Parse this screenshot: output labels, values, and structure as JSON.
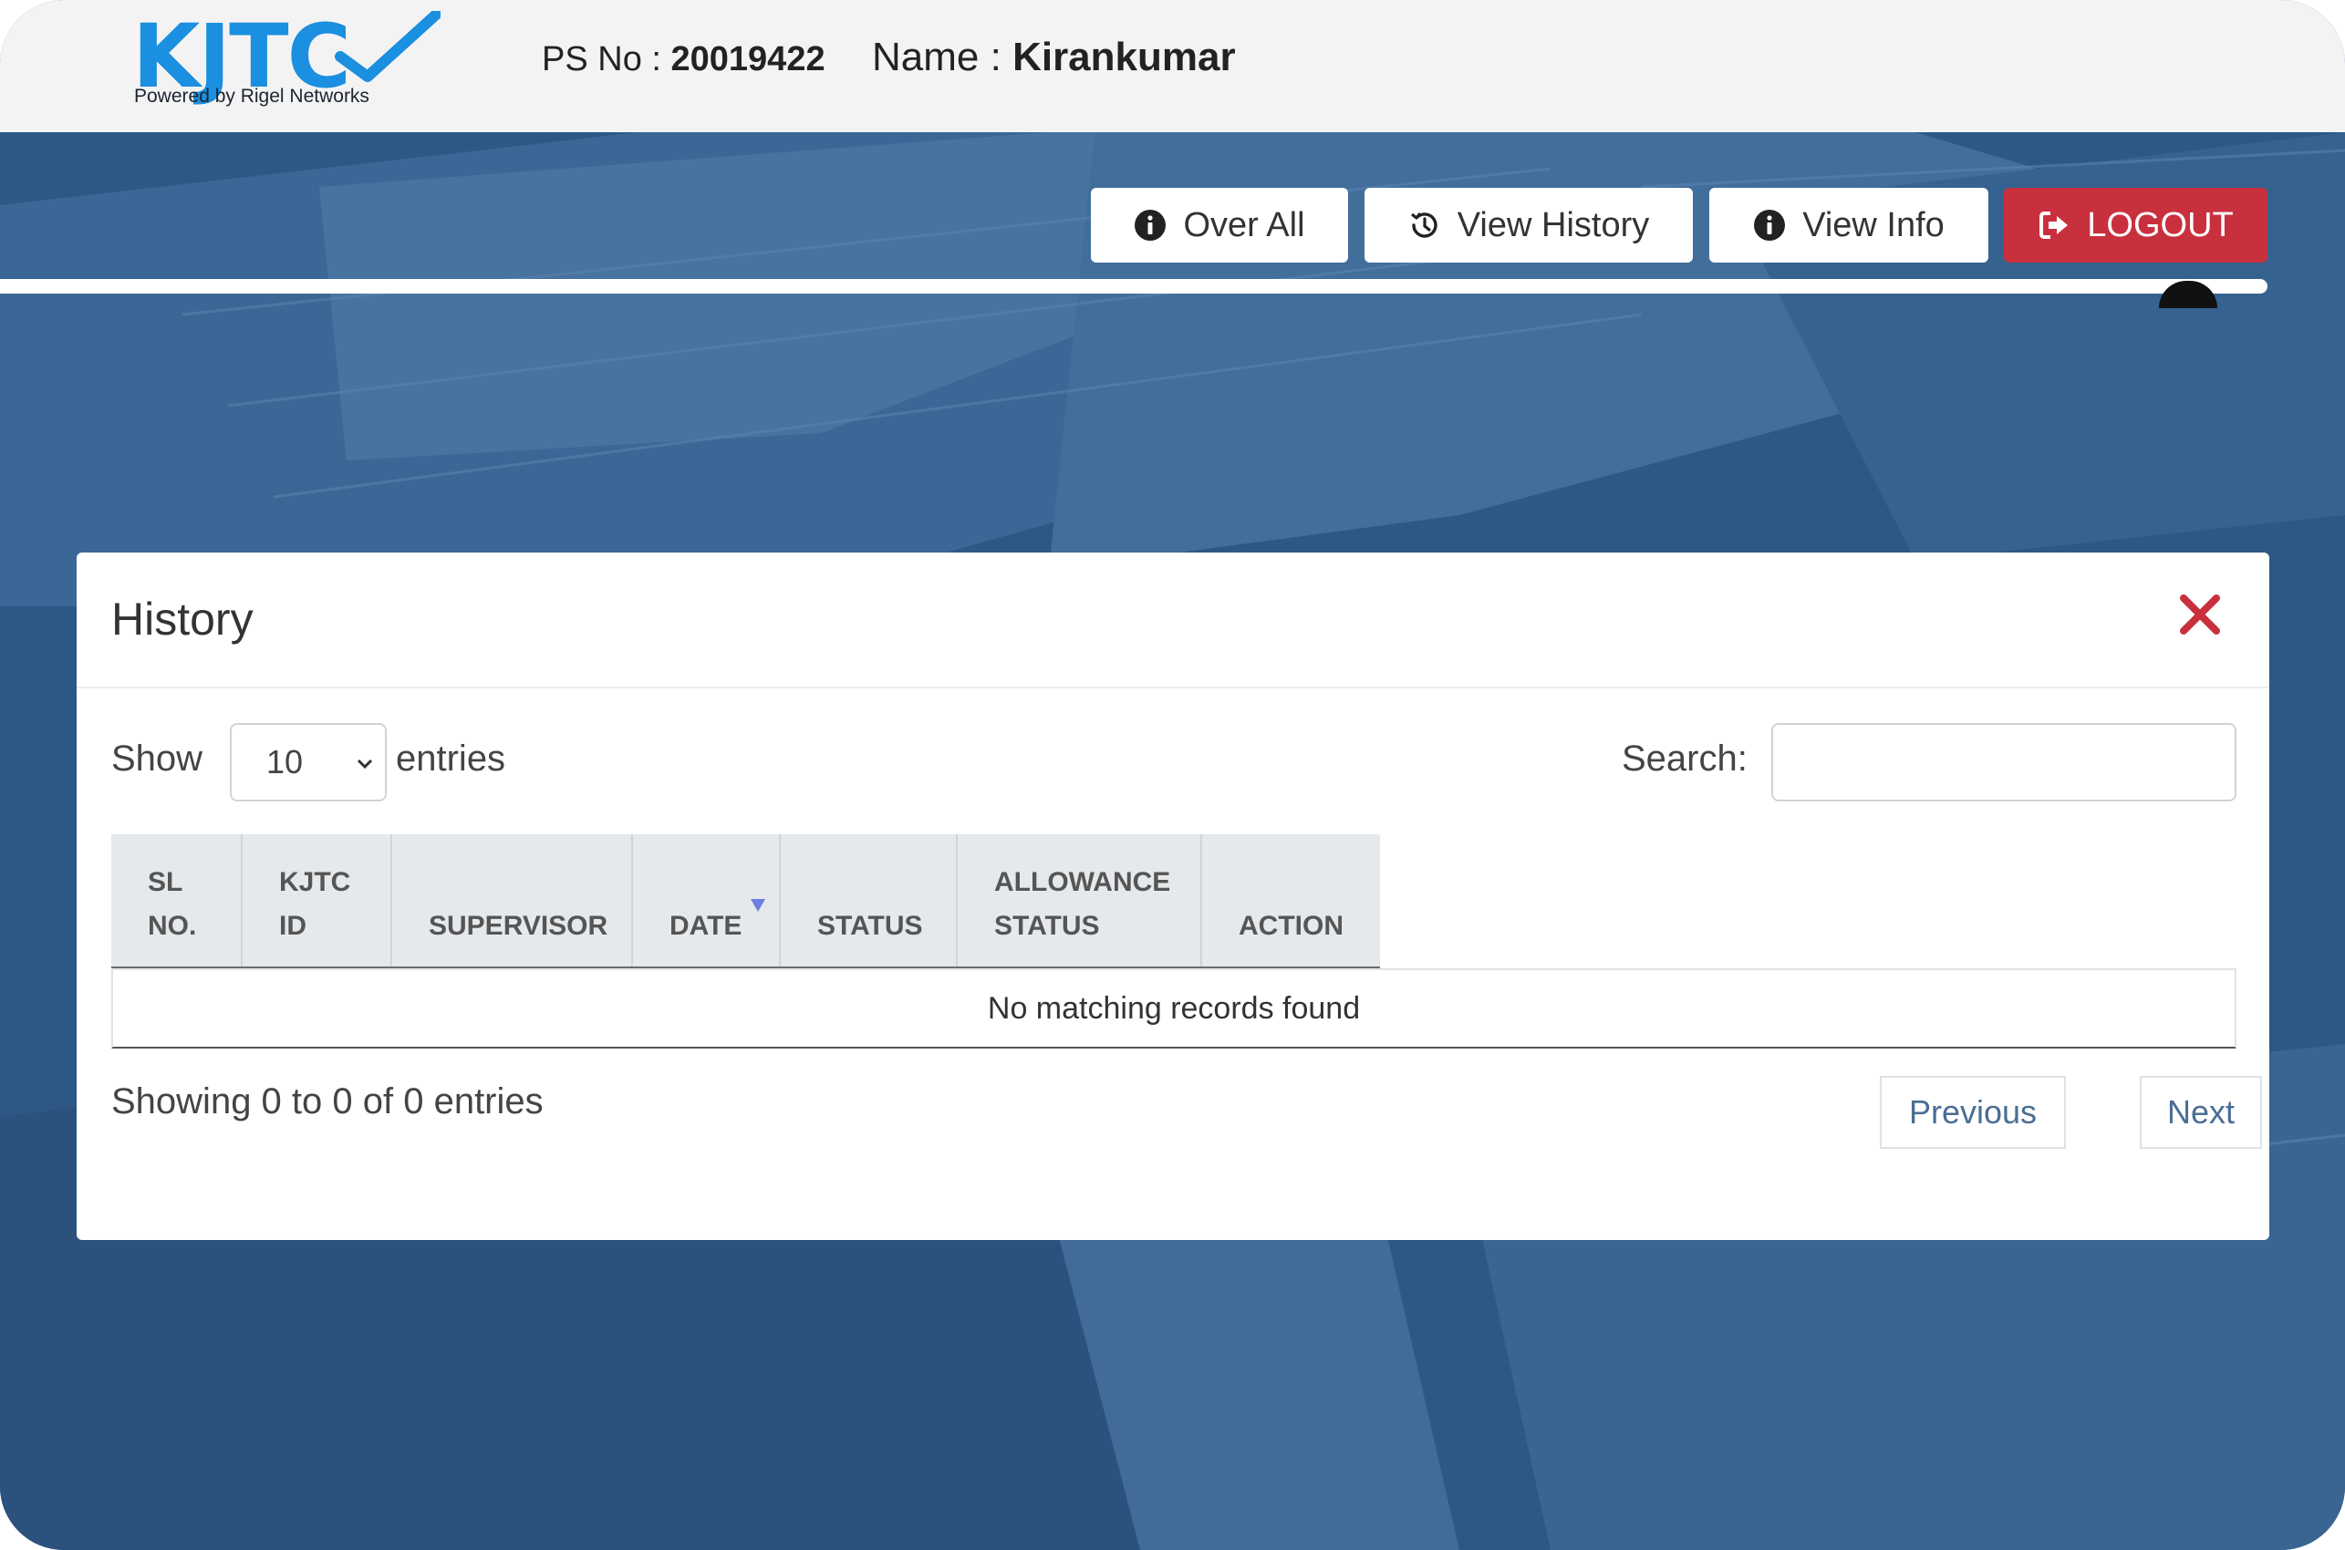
{
  "header": {
    "logo_text": "KJTC",
    "logo_tagline": "Powered by Rigel Networks",
    "ps_no_label": "PS No :",
    "ps_no_value": "20019422",
    "name_label": "Name :",
    "name_value": "Kirankumar"
  },
  "nav": {
    "overall_label": "Over All",
    "view_history_label": "View History",
    "view_info_label": "View Info",
    "logout_label": "LOGOUT"
  },
  "modal": {
    "title": "History",
    "show_label": "Show",
    "entries_label": "entries",
    "page_length_value": "10",
    "search_label": "Search:",
    "search_value": "",
    "columns": [
      {
        "line1": "SL",
        "line2": "NO."
      },
      {
        "line1": "KJTC",
        "line2": "ID"
      },
      {
        "line1": "",
        "line2": "SUPERVISOR"
      },
      {
        "line1": "",
        "line2": "DATE"
      },
      {
        "line1": "",
        "line2": "STATUS"
      },
      {
        "line1": "ALLOWANCE",
        "line2": "STATUS"
      },
      {
        "line1": "",
        "line2": "ACTION"
      }
    ],
    "empty_message": "No matching records found",
    "info": "Showing 0 to 0 of 0 entries",
    "previous_label": "Previous",
    "next_label": "Next"
  },
  "colors": {
    "accent_blue": "#1b8fe0",
    "logout_red": "#c9303e",
    "close_red": "#c9303e",
    "sort_arrow": "#6f7ee0",
    "overlay_blue": "#2f5a8a"
  }
}
